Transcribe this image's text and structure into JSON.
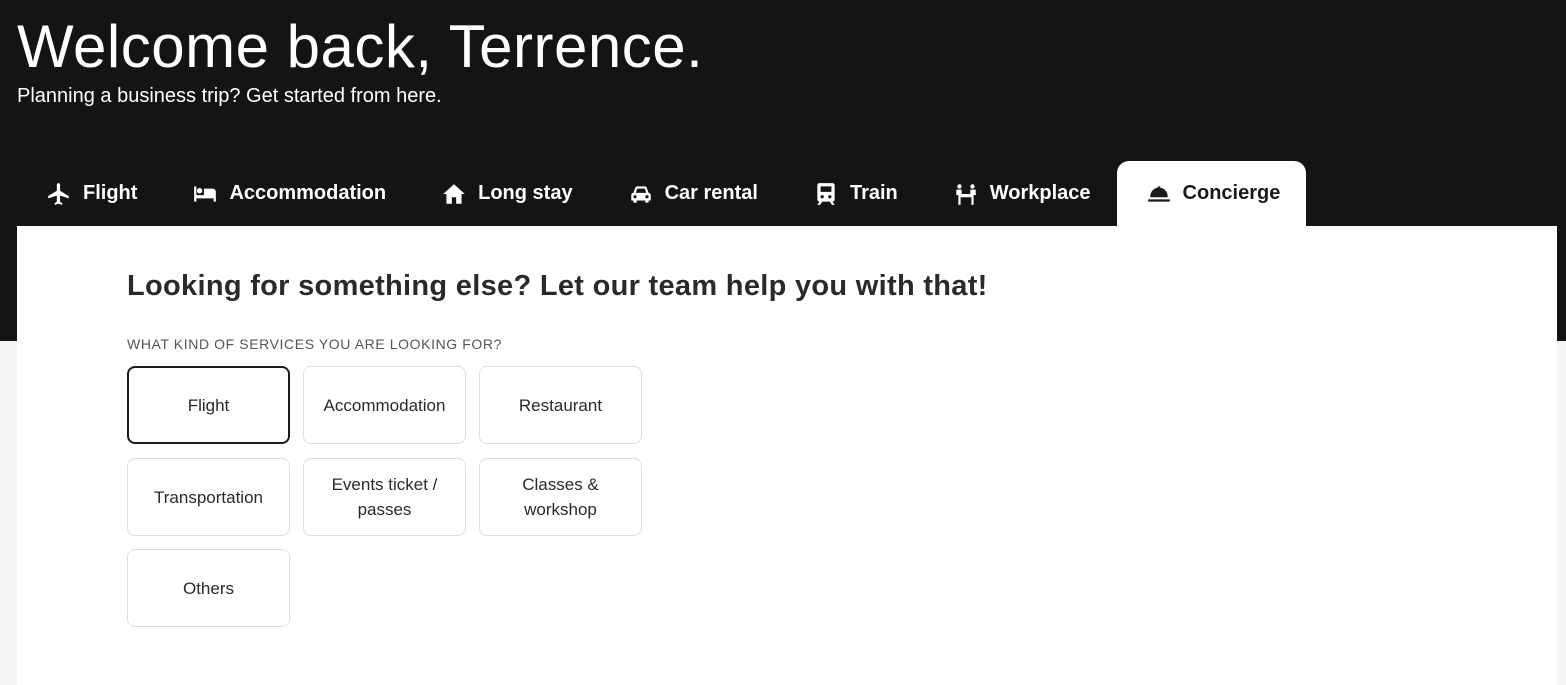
{
  "header": {
    "title": "Welcome back, Terrence.",
    "subtitle": "Planning a business trip? Get started from here."
  },
  "tabs": [
    {
      "label": "Flight",
      "icon": "airplane-icon"
    },
    {
      "label": "Accommodation",
      "icon": "bed-icon"
    },
    {
      "label": "Long stay",
      "icon": "home-icon"
    },
    {
      "label": "Car rental",
      "icon": "car-icon"
    },
    {
      "label": "Train",
      "icon": "train-icon"
    },
    {
      "label": "Workplace",
      "icon": "workplace-icon"
    },
    {
      "label": "Concierge",
      "icon": "concierge-bell-icon",
      "active": true
    }
  ],
  "concierge": {
    "title": "Looking for something else? Let our team help you with that!",
    "services_label": "WHAT KIND OF SERVICES YOU ARE LOOKING FOR?",
    "options": [
      {
        "label": "Flight",
        "selected": true
      },
      {
        "label": "Accommodation"
      },
      {
        "label": "Restaurant"
      },
      {
        "label": "Transportation"
      },
      {
        "label": "Events ticket / passes"
      },
      {
        "label": "Classes & workshop"
      },
      {
        "label": "Others"
      }
    ]
  },
  "colors": {
    "header_bg": "#141414",
    "card_bg": "#ffffff",
    "selected_border": "#1a1a1a"
  }
}
